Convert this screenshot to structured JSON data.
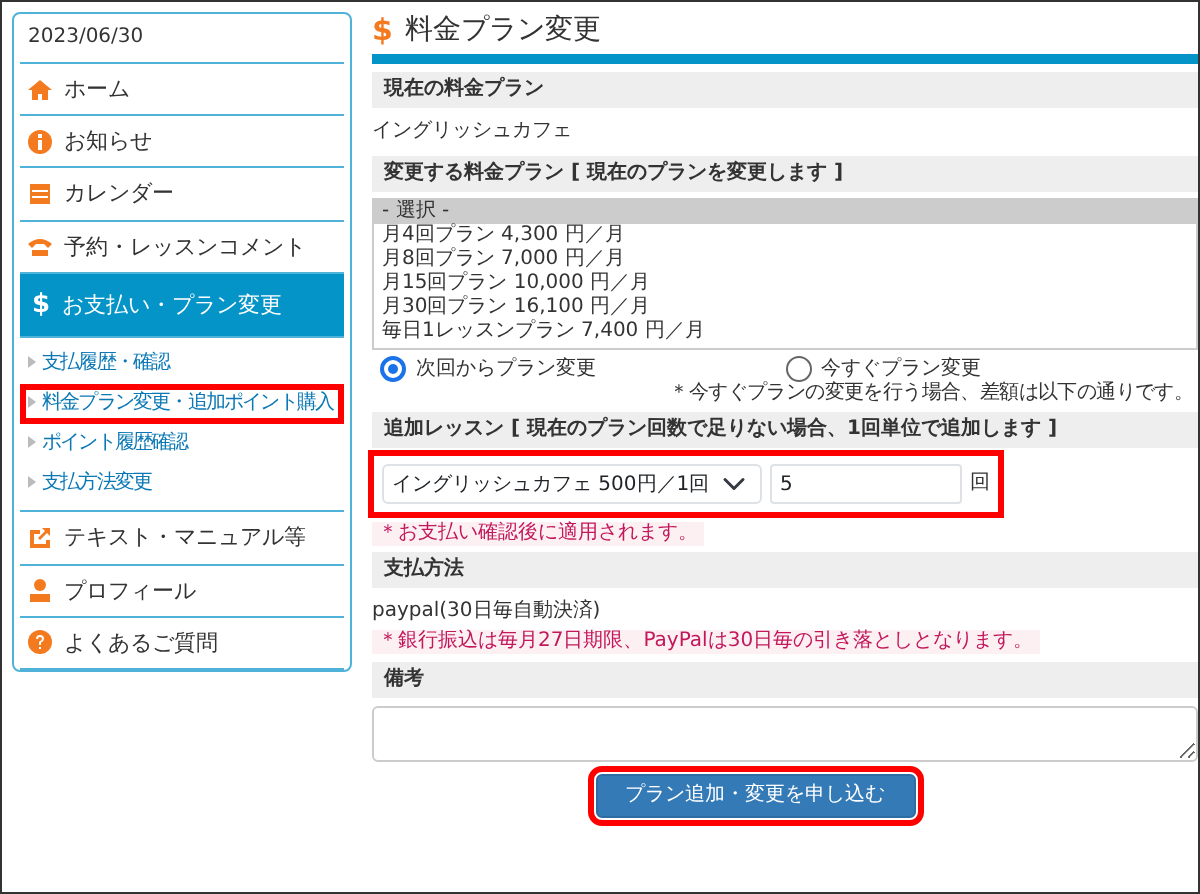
{
  "sidebar": {
    "date": "2023/06/30",
    "items": [
      {
        "label": "ホーム",
        "selected": false
      },
      {
        "label": "お知らせ",
        "selected": false
      },
      {
        "label": "カレンダー",
        "selected": false
      },
      {
        "label": "予約・レッスンコメント",
        "selected": false
      },
      {
        "label": "お支払い・プラン変更",
        "glyph": "$",
        "selected": true,
        "children": [
          {
            "label": "支払履歴・確認",
            "highlighted": false
          },
          {
            "label": "料金プラン変更・追加ポイント購入",
            "highlighted": true
          },
          {
            "label": "ポイント履歴確認",
            "highlighted": false
          },
          {
            "label": "支払方法変更",
            "highlighted": false
          }
        ]
      },
      {
        "label": "テキスト・マニュアル等",
        "selected": false
      },
      {
        "label": "プロフィール",
        "selected": false
      },
      {
        "label": "よくあるご質問",
        "selected": false
      }
    ]
  },
  "page": {
    "title_glyph": "$",
    "title": "料金プラン変更"
  },
  "current_plan": {
    "heading": "現在の料金プラン",
    "value": "イングリッシュカフェ"
  },
  "change_plan": {
    "heading": "変更する料金プラン",
    "heading_note": "[ 現在のプランを変更します ]",
    "options": [
      {
        "label": "- 選択 -",
        "selected": true
      },
      {
        "label": "月4回プラン 4,300 円／月",
        "selected": false
      },
      {
        "label": "月8回プラン 7,000 円／月",
        "selected": false
      },
      {
        "label": "月15回プラン 10,000 円／月",
        "selected": false
      },
      {
        "label": "月30回プラン 16,100 円／月",
        "selected": false
      },
      {
        "label": "毎日1レッスンプラン 7,400 円／月",
        "selected": false
      }
    ],
    "timing": [
      {
        "label": "次回からプラン変更",
        "selected": true
      },
      {
        "label": "今すぐプラン変更",
        "selected": false
      }
    ],
    "note": "＊今すぐプランの変更を行う場合、差額は以下の通りです。"
  },
  "additional_lesson": {
    "heading": "追加レッスン",
    "heading_note": "[ 現在のプラン回数で足りない場合、1回単位で追加します ]",
    "select_value": "イングリッシュカフェ 500円／1回",
    "count_value": "5",
    "unit": "回",
    "note": "＊お支払い確認後に適用されます。",
    "highlighted": true
  },
  "payment": {
    "heading": "支払方法",
    "value": "paypal(30日毎自動決済)",
    "note": "＊銀行振込は毎月27日期限、PayPalは30日毎の引き落としとなります。"
  },
  "remarks": {
    "heading": "備考"
  },
  "submit": {
    "label": "プラン追加・変更を申し込む",
    "highlighted": true
  }
}
